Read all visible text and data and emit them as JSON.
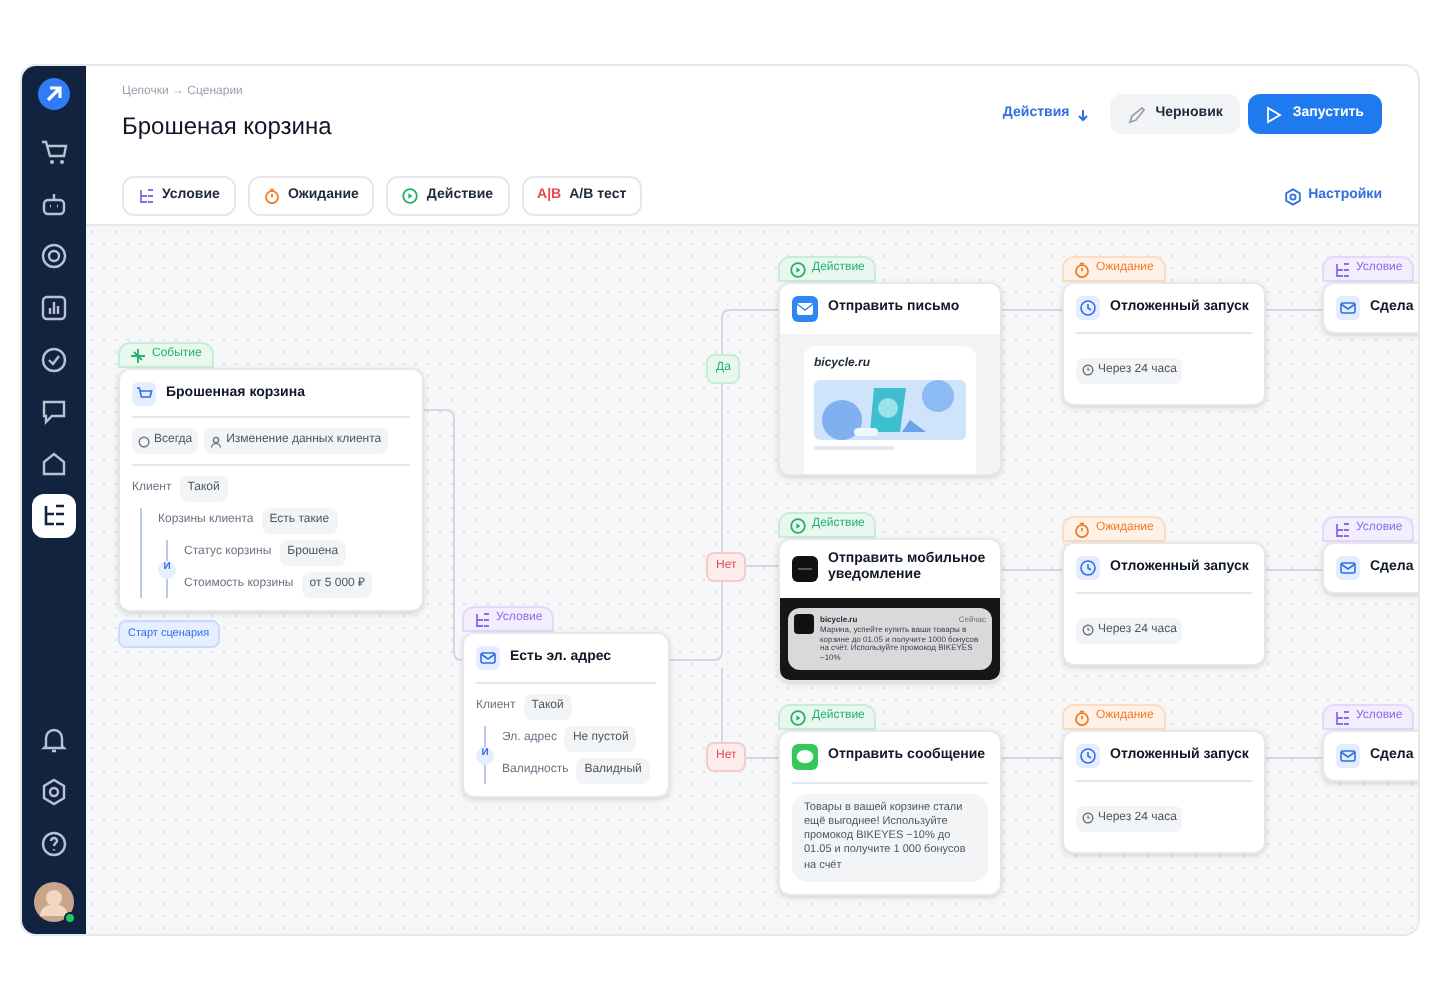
{
  "sidebar": {
    "items": [
      {
        "selected": false
      },
      {
        "selected": false
      },
      {
        "selected": false
      },
      {
        "selected": false
      },
      {
        "selected": false
      },
      {
        "selected": false
      },
      {
        "selected": false
      },
      {
        "selected": true
      }
    ]
  },
  "header": {
    "breadcrumb": "Цепочки → Сценарии",
    "title": "Брошеная корзина",
    "actions_link": "Действия",
    "buttons": [
      {
        "label": "Черновик",
        "kind": "secondary"
      },
      {
        "label": "Запустить",
        "kind": "primary"
      }
    ]
  },
  "toolbar": {
    "blocks": [
      {
        "label": "Условие",
        "kind": "condition"
      },
      {
        "label": "Ожидание",
        "kind": "wait"
      },
      {
        "label": "Действие",
        "kind": "action"
      },
      {
        "label": "A/B тест",
        "kind": "ab",
        "badge": "A|B"
      }
    ],
    "settings": "Настройки"
  },
  "canvas": {
    "start_badge": "Старт сценария",
    "branches": [
      {
        "label": "Да",
        "kind": "yes"
      },
      {
        "label": "Нет",
        "kind": "no"
      },
      {
        "label": "Нет",
        "kind": "no"
      }
    ],
    "nodes": [
      {
        "kind": "event",
        "tag": "Событие",
        "title": "Брошенная корзина",
        "chips": [
          "Всегда",
          "Изменение данных клиента"
        ],
        "rules": [
          {
            "label": "Клиент",
            "value": "Такой",
            "children": [
              {
                "label": "Корзины клиента",
                "value": "Есть такие",
                "joiner": "И",
                "children": [
                  {
                    "label": "Статус корзины",
                    "value": "Брошена"
                  },
                  {
                    "label": "Стоимость корзины",
                    "value": "от 5 000 ₽"
                  }
                ]
              }
            ]
          }
        ]
      },
      {
        "kind": "condition",
        "tag": "Условие",
        "title": "Есть эл. адрес",
        "rules": [
          {
            "label": "Клиент",
            "value": "Такой",
            "joiner": "И",
            "children": [
              {
                "label": "Эл. адрес",
                "value": "Не пустой"
              },
              {
                "label": "Валидность",
                "value": "Валидный"
              }
            ]
          }
        ]
      },
      {
        "kind": "email",
        "tag": "Действие",
        "title": "Отправить письмо",
        "brand": "bicycle.ru"
      },
      {
        "kind": "push",
        "tag": "Действие",
        "title": "Отправить мобильное уведомление",
        "push": {
          "app": "bicycle.ru",
          "time": "Сейчас",
          "text": "Марина, успейте купить ваши товары в корзине до 01.05 и получите 1000 бонусов на счёт. Используйте промокод BIKEYES −10%"
        }
      },
      {
        "kind": "sms",
        "tag": "Действие",
        "title": "Отправить сообщение",
        "message": "Товары в вашей корзине стали ещё выгоднее! Используйте промокод BIKEYES −10% до 01.05 и получите 1 000 бонусов на счёт"
      },
      {
        "kind": "wait",
        "tag": "Ожидание",
        "title": "Отложенный запуск",
        "chip": "Через 24 часа"
      },
      {
        "kind": "wait",
        "tag": "Ожидание",
        "title": "Отложенный запуск",
        "chip": "Через 24 часа"
      },
      {
        "kind": "wait",
        "tag": "Ожидание",
        "title": "Отложенный запуск",
        "chip": "Через 24 часа"
      },
      {
        "kind": "condition",
        "tag": "Условие",
        "title": "Сдела"
      },
      {
        "kind": "condition",
        "tag": "Условие",
        "title": "Сдела"
      },
      {
        "kind": "condition",
        "tag": "Условие",
        "title": "Сдела"
      }
    ]
  }
}
